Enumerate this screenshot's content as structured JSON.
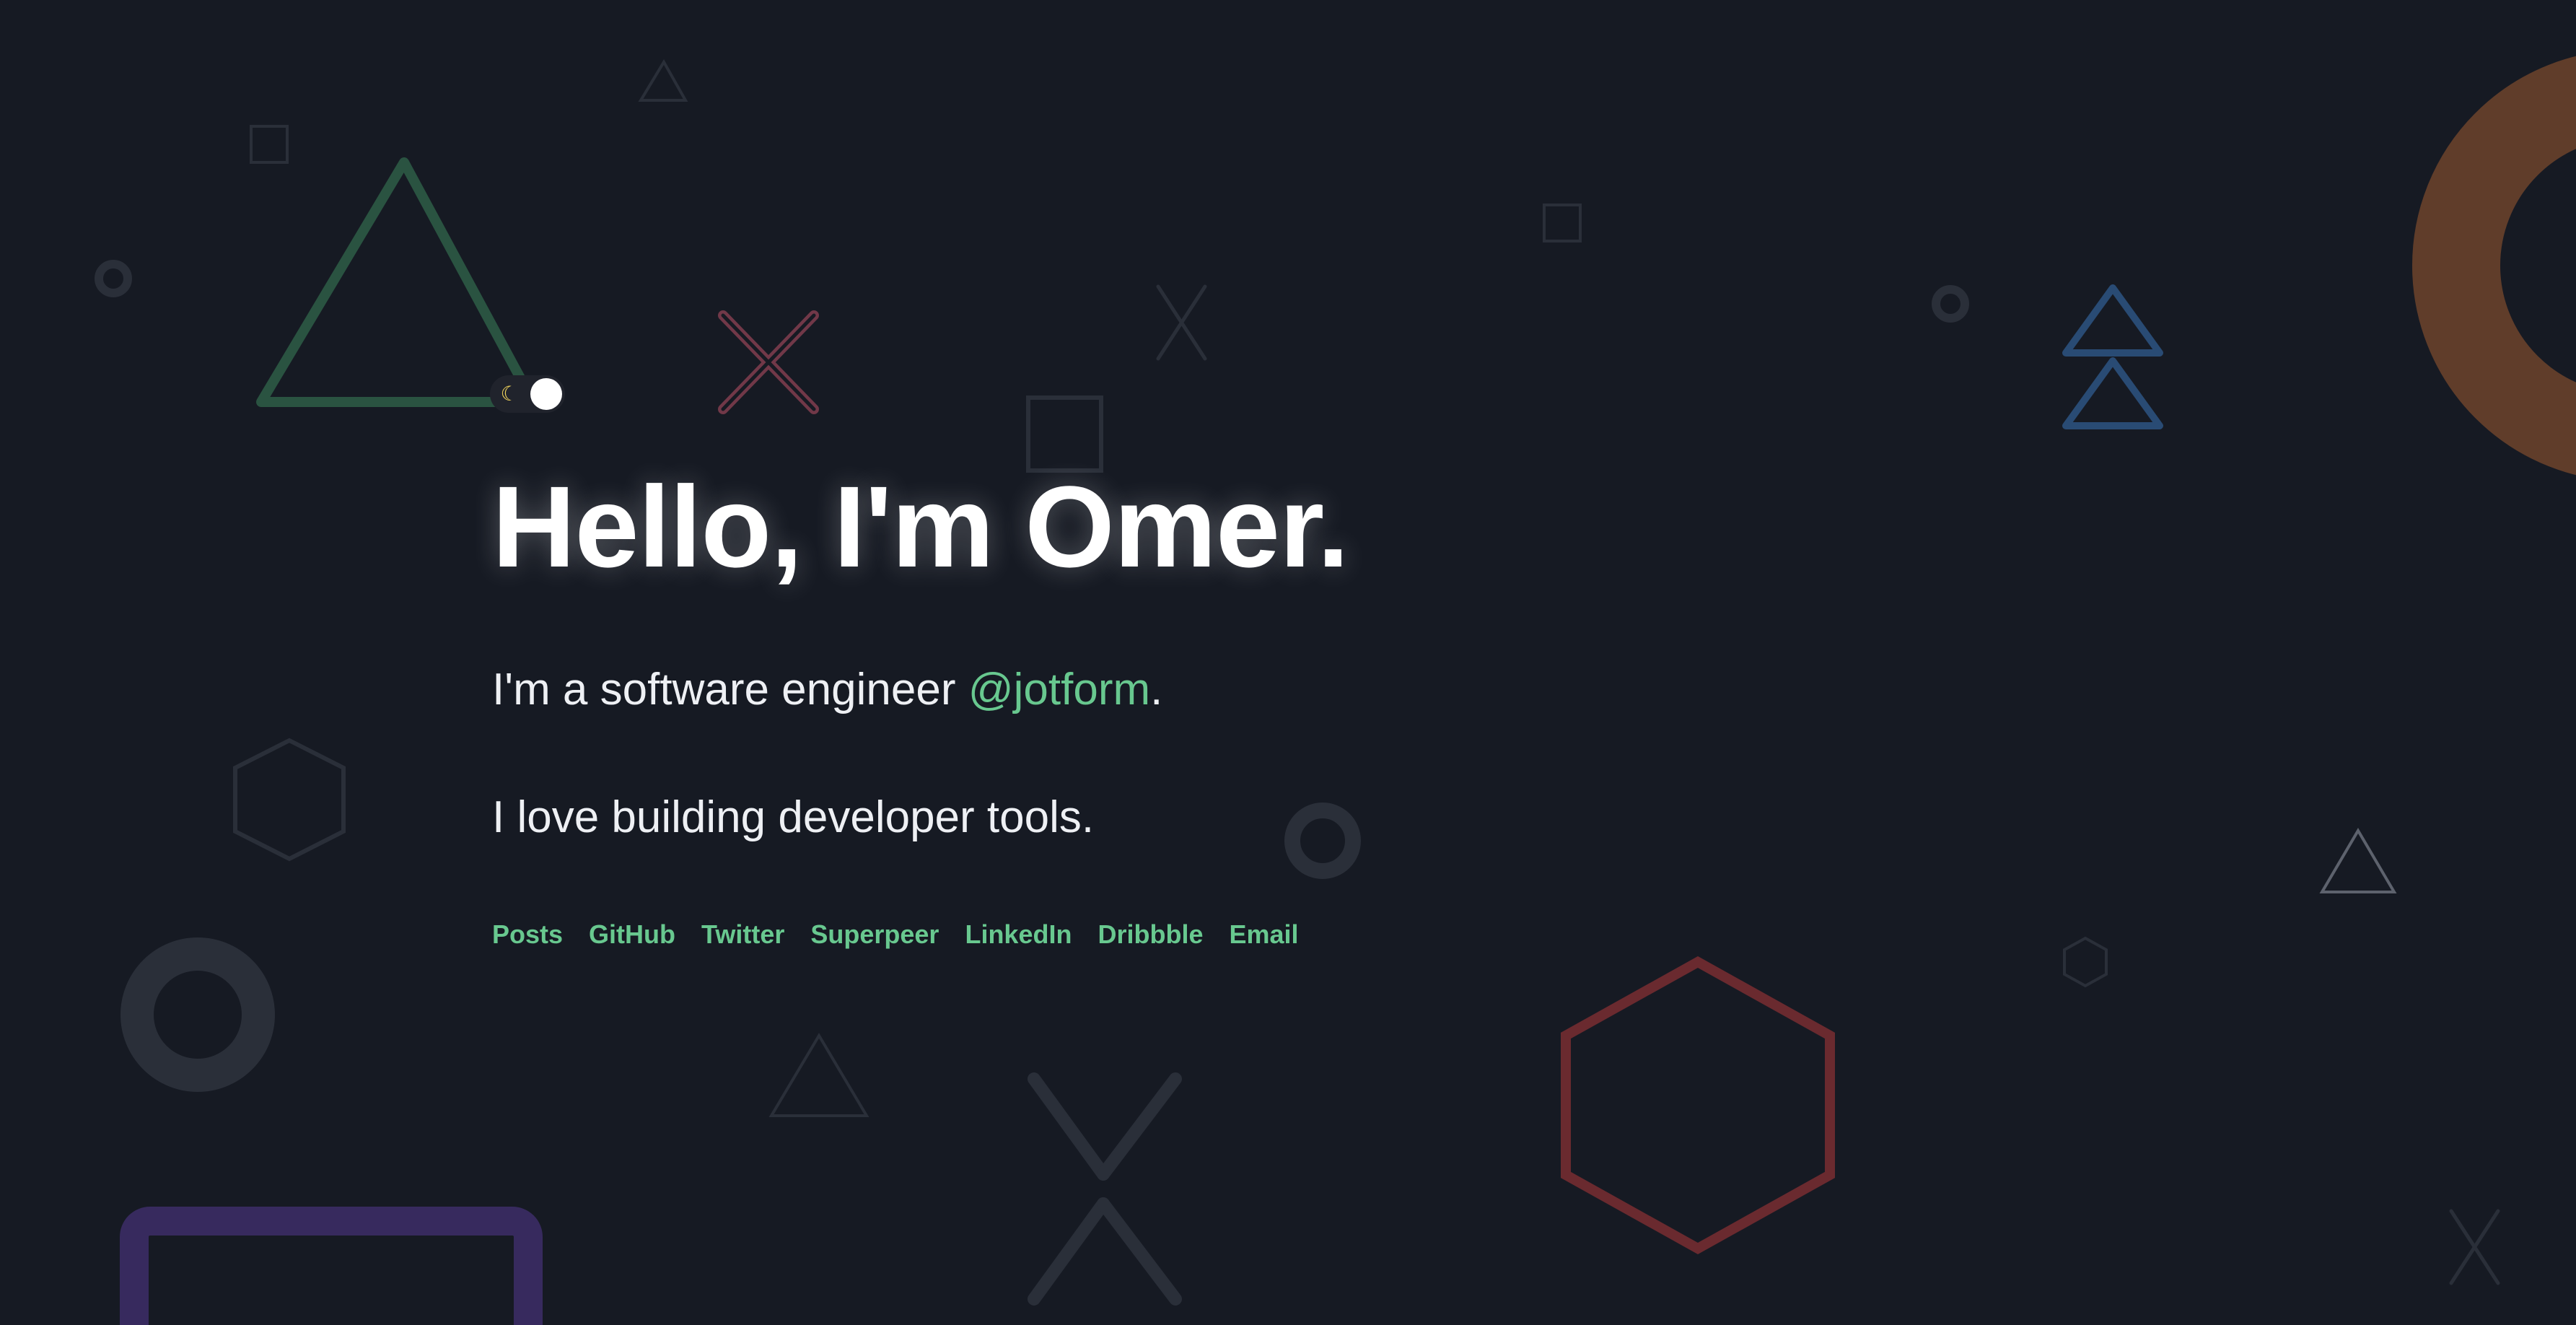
{
  "hero": {
    "title": "Hello, I'm Omer.",
    "intro_text": "I'm a software engineer ",
    "intro_accent": "@jotform",
    "intro_end": ".",
    "love_text": "I love building developer tools."
  },
  "links": [
    "Posts",
    "GitHub",
    "Twitter",
    "Superpeer",
    "LinkedIn",
    "Dribbble",
    "Email"
  ],
  "theme_toggle": {
    "icon": "moon-icon"
  },
  "colors": {
    "background": "#161a23",
    "accent": "#68c88f",
    "text": "#eef0f4",
    "shape_green": "#2a5341",
    "shape_pink": "#713848",
    "shape_blue": "#294b74",
    "shape_brown": "#603d2a",
    "shape_red": "#6a2a2f",
    "shape_purple": "#372a5e",
    "shape_gray": "#2a2f39",
    "shape_light_gray": "#5d626d"
  },
  "background_shapes": {
    "icons": [
      "triangle-icon",
      "square-icon",
      "circle-icon",
      "x-icon",
      "hexagon-icon",
      "ring-icon",
      "rectangle-icon"
    ]
  }
}
